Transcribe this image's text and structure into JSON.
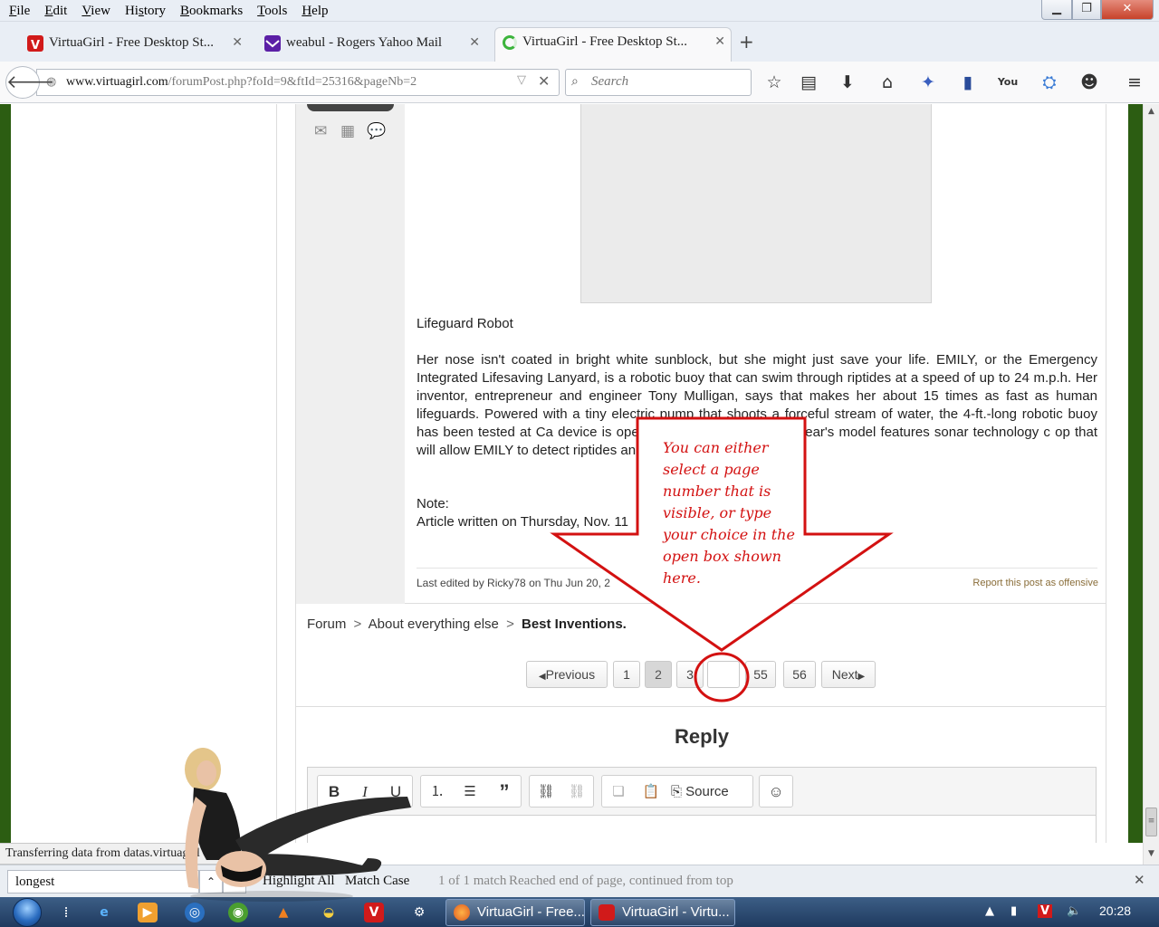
{
  "menu": {
    "items": [
      "File",
      "Edit",
      "View",
      "History",
      "Bookmarks",
      "Tools",
      "Help"
    ],
    "mnemonics": [
      "F",
      "E",
      "V",
      "s",
      "B",
      "T",
      "H"
    ]
  },
  "tabs": [
    {
      "label": "VirtuaGirl - Free Desktop St...",
      "icon": "virtuagirl-icon",
      "active": false
    },
    {
      "label": "weabul - Rogers Yahoo Mail",
      "icon": "mail-icon",
      "active": false
    },
    {
      "label": "VirtuaGirl - Free Desktop St...",
      "icon": "loading-icon",
      "active": true
    }
  ],
  "navbar": {
    "url_domain": "www.virtuagirl.com",
    "url_path": "/forumPost.php?foId=9&ftId=25316&pageNb=2",
    "search_placeholder": "Search"
  },
  "post": {
    "title": "Lifeguard Robot",
    "body": "Her nose isn't coated in bright white sunblock, but she might just save your life. EMILY, or the Emergency Integrated Lifesaving Lanyard, is a robotic buoy that can swim through riptides at a speed of up to 24 m.p.h. Her inventor, entrepreneur and engineer Tony Mulligan, says that makes her about 15 times as fast as human lifeguards. Powered with a tiny electric pump that shoots a forceful stream of water, the 4-ft.-long robotic buoy has been tested at Ca                                    device is operated by remote, but next year's model features sonar technology c                                    op that will allow EMILY to detect riptides and submerged objects.",
    "note_label": "Note:",
    "note_text": "Article written on Thursday, Nov. 11",
    "edited": "Last edited by Ricky78 on Thu Jun 20, 2",
    "report": "Report this post as offensive"
  },
  "breadcrumb": {
    "forum": "Forum",
    "section": "About everything else",
    "topic": "Best Inventions.",
    "sep": ">"
  },
  "pager": {
    "previous": "Previous",
    "pages": [
      "1",
      "2",
      "3",
      "",
      "55",
      "56"
    ],
    "current": "2",
    "next": "Next"
  },
  "reply": {
    "title": "Reply",
    "source_label": "Source"
  },
  "callout": {
    "lines": [
      "You can either",
      "select a page",
      "number that is",
      "visible, or type",
      "your choice in the",
      "open box shown",
      "here."
    ],
    "color": "#d31111"
  },
  "status": "Transferring data from datas.virtuagirl",
  "findbar": {
    "query": "longest",
    "highlight_all": "Highlight All",
    "match_case": "Match Case",
    "match_count": "1 of 1 match",
    "message": "Reached end of page, continued from top"
  },
  "taskbar": {
    "tasks": [
      "VirtuaGirl - Free...",
      "VirtuaGirl - Virtu..."
    ],
    "time": "20:28"
  },
  "colors": {
    "accent_green": "#2c5d12",
    "annotation_red": "#d31111",
    "report_link": "#8a6e3a"
  }
}
